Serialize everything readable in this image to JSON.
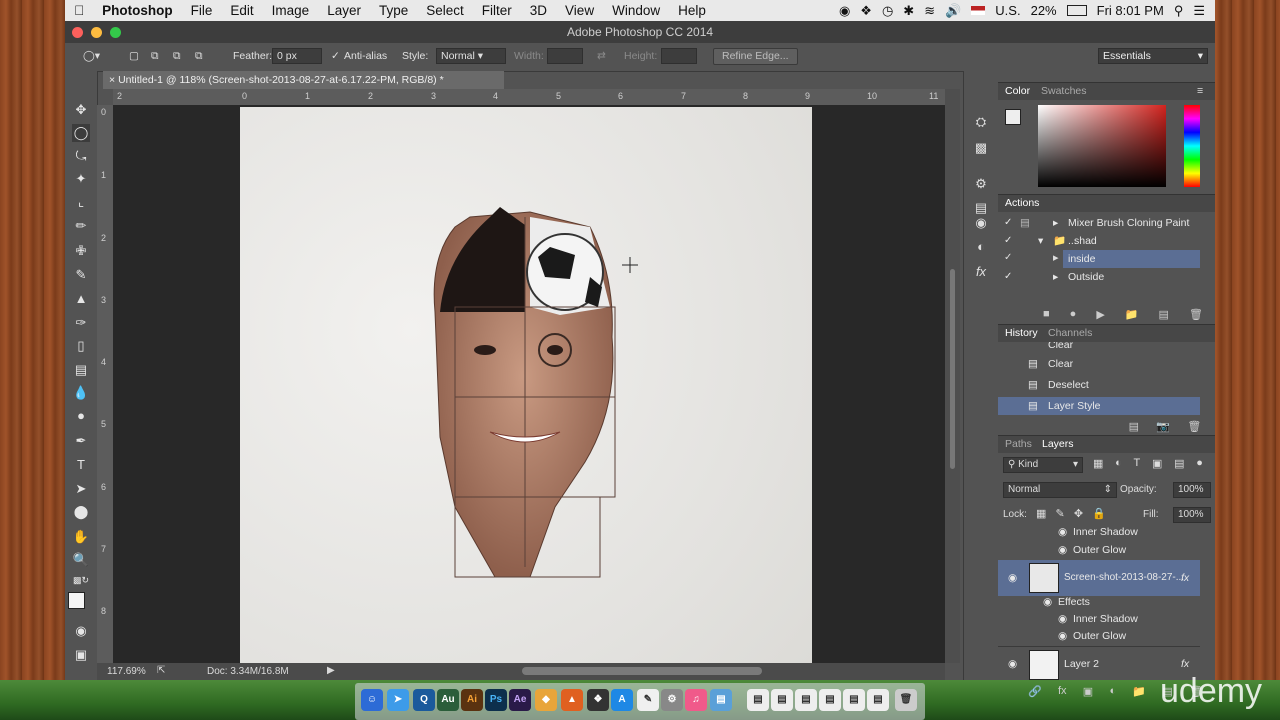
{
  "menubar": {
    "app": "Photoshop",
    "items": [
      "File",
      "Edit",
      "Image",
      "Layer",
      "Type",
      "Select",
      "Filter",
      "3D",
      "View",
      "Window",
      "Help"
    ],
    "locale": "U.S.",
    "battery": "22%",
    "clock": "Fri 8:01 PM"
  },
  "window": {
    "title": "Adobe Photoshop CC 2014"
  },
  "options": {
    "feather_label": "Feather:",
    "feather_value": "0 px",
    "antialias_label": "Anti-alias",
    "style_label": "Style:",
    "style_value": "Normal",
    "width_label": "Width:",
    "height_label": "Height:",
    "refine_edge": "Refine Edge...",
    "workspace": "Essentials"
  },
  "document": {
    "tab_title": "Untitled-1 @ 118% (Screen-shot-2013-08-27-at-6.17.22-PM, RGB/8) *",
    "ruler_h": [
      "2",
      "0",
      "1",
      "2",
      "3",
      "4",
      "5",
      "6",
      "7",
      "8",
      "9",
      "10",
      "11"
    ],
    "ruler_v": [
      "0",
      "1",
      "2",
      "3",
      "4",
      "5",
      "6",
      "7",
      "8"
    ],
    "zoom": "117.69%",
    "doc_size": "Doc: 3.34M/16.8M"
  },
  "panels": {
    "color_tabs": [
      "Color",
      "Swatches"
    ],
    "actions_title": "Actions",
    "actions": [
      "Mixer Brush Cloning Paint ...",
      "shad",
      "inside",
      "Outside"
    ],
    "history_tabs": [
      "History",
      "Channels"
    ],
    "history": [
      "Clear",
      "Clear",
      "Deselect",
      "Layer Style"
    ],
    "layers_tabs": [
      "Paths",
      "Layers"
    ],
    "kind": "Kind",
    "blend_mode": "Normal",
    "opacity_label": "Opacity:",
    "opacity_value": "100%",
    "lock_label": "Lock:",
    "fill_label": "Fill:",
    "fill_value": "100%",
    "layer_rows": {
      "inner_shadow_top": "Inner Shadow",
      "outer_glow_top": "Outer Glow",
      "layer1": "Screen-shot-2013-08-27-...",
      "effects": "Effects",
      "inner_shadow": "Inner Shadow",
      "outer_glow": "Outer Glow",
      "layer2": "Layer 2",
      "fx": "fx"
    }
  },
  "watermark": "udemy",
  "colors": {
    "selection": "#5b6e94",
    "panel": "#535353",
    "pasteboard": "#282828"
  }
}
